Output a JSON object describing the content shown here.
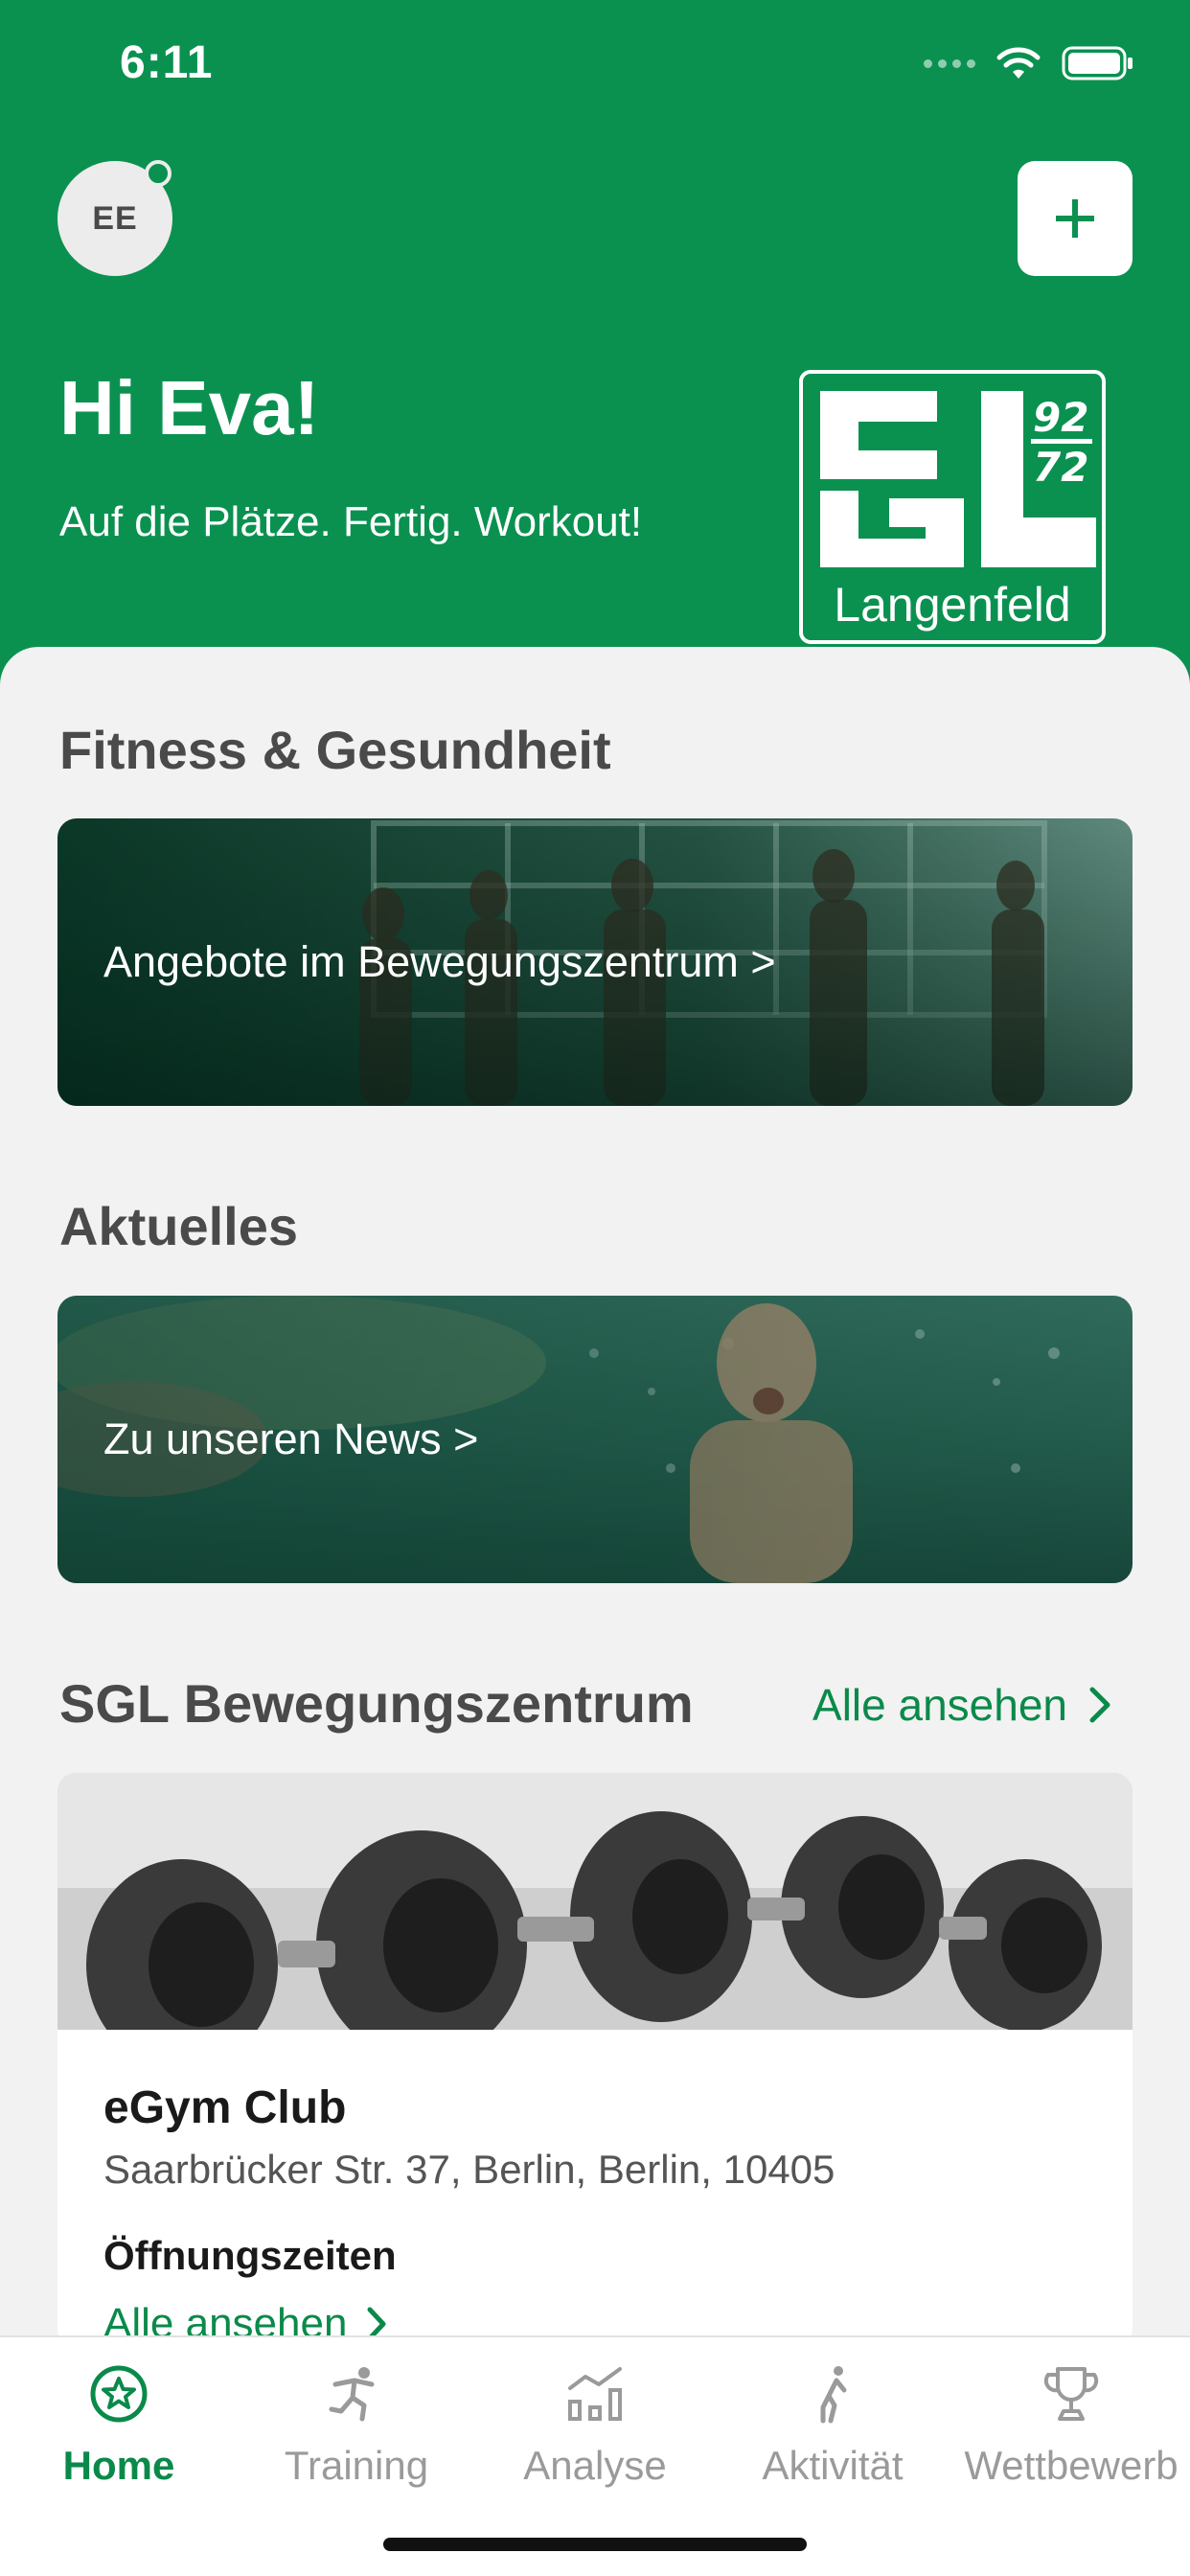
{
  "status_bar": {
    "time": "6:11"
  },
  "header": {
    "avatar_initials": "EE",
    "greeting": "Hi Eva!",
    "tagline": "Auf die Plätze. Fertig. Workout!",
    "logo_text": "Langenfeld",
    "logo_numbers": [
      "92",
      "72"
    ]
  },
  "sections": {
    "fitness": {
      "title": "Fitness & Gesundheit",
      "banner_label": "Angebote im Bewegungszentrum >"
    },
    "news": {
      "title": "Aktuelles",
      "banner_label": "Zu unseren News >"
    },
    "center": {
      "title": "SGL Bewegungszentrum",
      "see_all": "Alle ansehen",
      "club": {
        "name": "eGym Club",
        "address": "Saarbrücker Str. 37, Berlin, Berlin, 10405",
        "hours_label": "Öffnungszeiten",
        "hours_link": "Alle ansehen"
      }
    }
  },
  "tabs": [
    {
      "label": "Home",
      "icon": "star-badge-icon",
      "active": true
    },
    {
      "label": "Training",
      "icon": "running-person-icon",
      "active": false
    },
    {
      "label": "Analyse",
      "icon": "bar-chart-icon",
      "active": false
    },
    {
      "label": "Aktivität",
      "icon": "walking-person-icon",
      "active": false
    },
    {
      "label": "Wettbewerb",
      "icon": "trophy-icon",
      "active": false
    }
  ],
  "colors": {
    "brand_green": "#0a9150",
    "link_green": "#0a8a4a",
    "inactive_gray": "#9a9a9a"
  }
}
